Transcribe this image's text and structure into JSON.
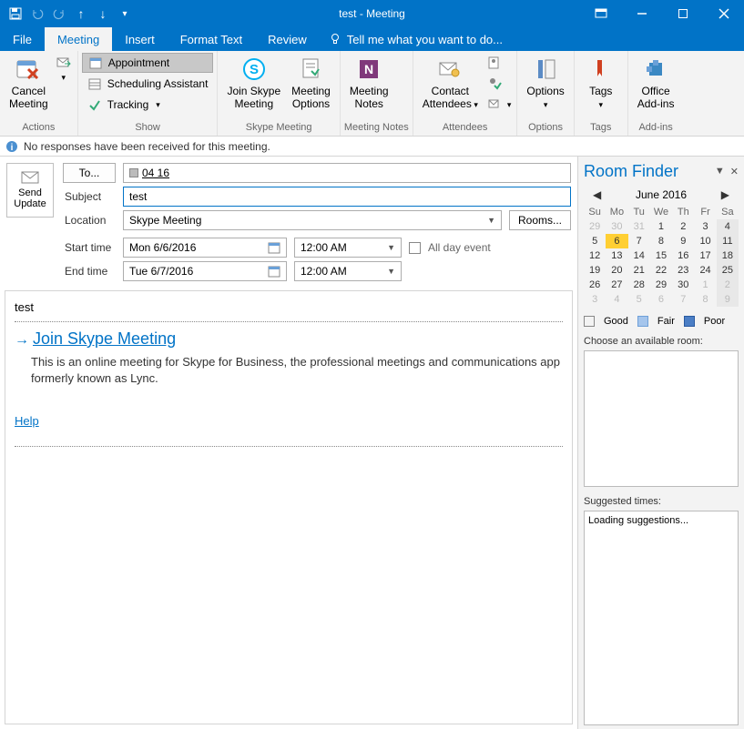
{
  "title": "test - Meeting",
  "menus": {
    "file": "File",
    "meeting": "Meeting",
    "insert": "Insert",
    "format": "Format Text",
    "review": "Review",
    "tellme": "Tell me what you want to do..."
  },
  "ribbon": {
    "actions": {
      "label": "Actions",
      "cancel": "Cancel\nMeeting"
    },
    "show": {
      "label": "Show",
      "appointment": "Appointment",
      "scheduling": "Scheduling Assistant",
      "tracking": "Tracking"
    },
    "skype": {
      "label": "Skype Meeting",
      "join": "Join Skype\nMeeting",
      "options": "Meeting\nOptions"
    },
    "notes": {
      "label": "Meeting Notes",
      "notes": "Meeting\nNotes"
    },
    "attendees": {
      "label": "Attendees",
      "contact": "Contact\nAttendees"
    },
    "options": {
      "label": "Options",
      "options": "Options"
    },
    "tags": {
      "label": "Tags",
      "tags": "Tags"
    },
    "addins": {
      "label": "Add-ins",
      "office": "Office\nAdd-ins"
    }
  },
  "infobar": "No responses have been received for this meeting.",
  "form": {
    "send": "Send\nUpdate",
    "to_label": "To...",
    "to_value": "04 16",
    "subject_label": "Subject",
    "subject_value": "test",
    "location_label": "Location",
    "location_value": "Skype Meeting",
    "rooms_btn": "Rooms...",
    "start_label": "Start time",
    "start_date": "Mon 6/6/2016",
    "start_time": "12:00 AM",
    "end_label": "End time",
    "end_date": "Tue 6/7/2016",
    "end_time": "12:00 AM",
    "allday": "All day event"
  },
  "body": {
    "header": "test",
    "link": "Join Skype Meeting",
    "desc": "This is an online meeting for Skype for Business, the professional meetings and communications app formerly known as Lync.",
    "help": "Help"
  },
  "sidebar": {
    "title": "Room Finder",
    "month": "June 2016",
    "dow": [
      "Su",
      "Mo",
      "Tu",
      "We",
      "Th",
      "Fr",
      "Sa"
    ],
    "weeks": [
      [
        {
          "d": 29,
          "o": true
        },
        {
          "d": 30,
          "o": true
        },
        {
          "d": 31,
          "o": true
        },
        {
          "d": 1
        },
        {
          "d": 2
        },
        {
          "d": 3
        },
        {
          "d": 4,
          "s": true
        }
      ],
      [
        {
          "d": 5
        },
        {
          "d": 6,
          "t": true
        },
        {
          "d": 7
        },
        {
          "d": 8
        },
        {
          "d": 9
        },
        {
          "d": 10
        },
        {
          "d": 11,
          "s": true
        }
      ],
      [
        {
          "d": 12
        },
        {
          "d": 13
        },
        {
          "d": 14
        },
        {
          "d": 15
        },
        {
          "d": 16
        },
        {
          "d": 17
        },
        {
          "d": 18,
          "s": true
        }
      ],
      [
        {
          "d": 19
        },
        {
          "d": 20
        },
        {
          "d": 21
        },
        {
          "d": 22
        },
        {
          "d": 23
        },
        {
          "d": 24
        },
        {
          "d": 25,
          "s": true
        }
      ],
      [
        {
          "d": 26
        },
        {
          "d": 27
        },
        {
          "d": 28
        },
        {
          "d": 29
        },
        {
          "d": 30
        },
        {
          "d": 1,
          "o": true
        },
        {
          "d": 2,
          "o": true,
          "s": true
        }
      ],
      [
        {
          "d": 3,
          "o": true
        },
        {
          "d": 4,
          "o": true
        },
        {
          "d": 5,
          "o": true
        },
        {
          "d": 6,
          "o": true
        },
        {
          "d": 7,
          "o": true
        },
        {
          "d": 8,
          "o": true
        },
        {
          "d": 9,
          "o": true,
          "s": true
        }
      ]
    ],
    "legend": {
      "good": "Good",
      "fair": "Fair",
      "poor": "Poor"
    },
    "choose": "Choose an available room:",
    "suggested": "Suggested times:",
    "loading": "Loading suggestions..."
  }
}
